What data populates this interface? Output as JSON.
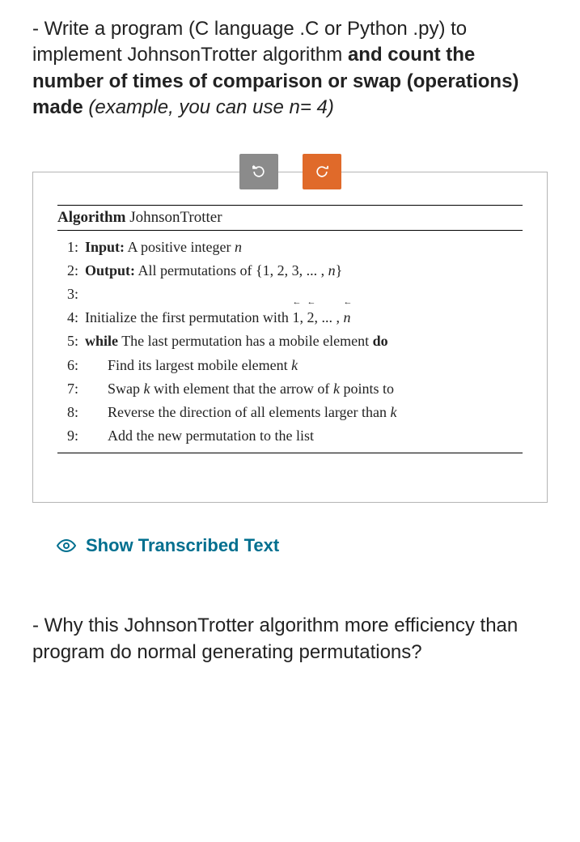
{
  "q1": {
    "prefix": "- Write a program (C language .C or Python .py) to implement JohnsonTrotter algorithm ",
    "bold": "and count the number of times of comparison or swap (operations) made",
    "italic": "  (example, you can use n= 4)"
  },
  "toolbar": {
    "undo_icon": "undo",
    "redo_icon": "redo"
  },
  "algorithm": {
    "header_label": "Algorithm",
    "header_name": "JohnsonTrotter",
    "lines": [
      {
        "num": "1:",
        "pre": "Input:",
        "text": " A positive integer ",
        "var": "n",
        "indent": false
      },
      {
        "num": "2:",
        "pre": "Output:",
        "text": " All permutations of {1, 2, 3, ... , ",
        "var": "n",
        "suffix": "}",
        "indent": false
      },
      {
        "num": "3:",
        "pre": "",
        "text": "",
        "indent": false
      },
      {
        "num": "4:",
        "pre": "",
        "text": "Initialize the first permutation with 1⃖, 2⃖, ... , n⃖",
        "indent": false,
        "raw": true
      },
      {
        "num": "5:",
        "pre": "while",
        "text": " The last permutation has a mobile element ",
        "post": "do",
        "indent": false
      },
      {
        "num": "6:",
        "pre": "",
        "text": "Find its largest mobile element ",
        "var": "k",
        "indent": true
      },
      {
        "num": "7:",
        "pre": "",
        "text": "Swap ",
        "var": "k",
        "mid": " with element that the arrow of ",
        "var2": "k",
        "suffix": " points to",
        "indent": true
      },
      {
        "num": "8:",
        "pre": "",
        "text": "Reverse the direction of all elements larger than ",
        "var": "k",
        "indent": true
      },
      {
        "num": "9:",
        "pre": "",
        "text": "Add the new permutation to the list",
        "indent": true
      }
    ]
  },
  "transcribed": {
    "label": "Show Transcribed Text"
  },
  "q2": {
    "text": "- Why this JohnsonTrotter algorithm more efficiency than program do normal generating permutations?"
  }
}
